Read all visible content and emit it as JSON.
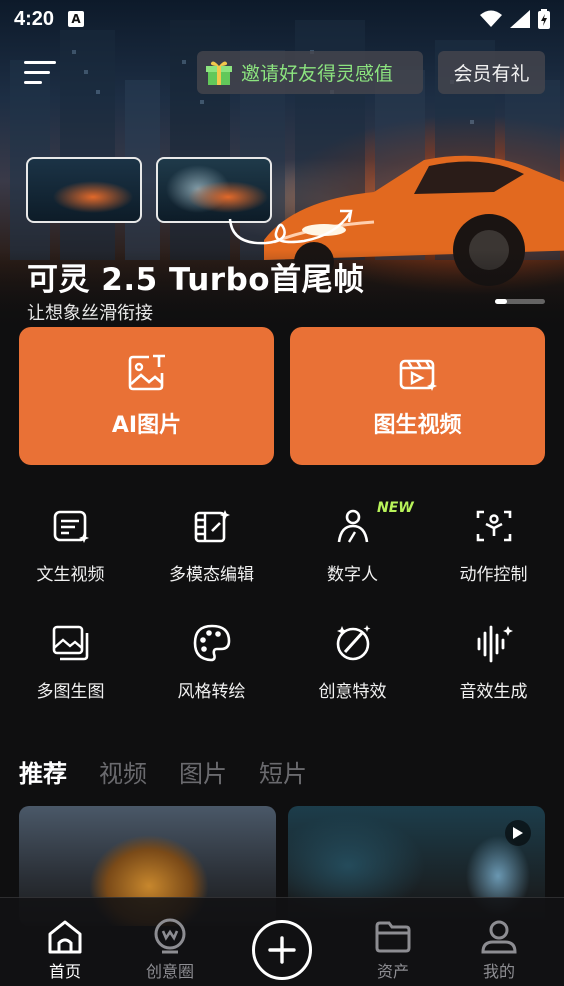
{
  "status": {
    "time": "4:20",
    "a_label": "A"
  },
  "header": {
    "invite_label": "邀请好友得灵感值",
    "vip_label": "会员有礼"
  },
  "hero": {
    "title": "可灵 2.5 Turbo首尾帧",
    "subtitle": "让想象丝滑衔接"
  },
  "cards": {
    "ai_image": "AI图片",
    "image_to_video": "图生视频"
  },
  "grid": {
    "items": [
      {
        "label": "文生视频",
        "icon": "text-video-icon"
      },
      {
        "label": "多模态编辑",
        "icon": "multimodal-edit-icon"
      },
      {
        "label": "数字人",
        "icon": "digital-human-icon"
      },
      {
        "label": "动作控制",
        "icon": "motion-control-icon"
      },
      {
        "label": "多图生图",
        "icon": "multi-image-icon"
      },
      {
        "label": "风格转绘",
        "icon": "palette-icon"
      },
      {
        "label": "创意特效",
        "icon": "creative-effect-icon"
      },
      {
        "label": "音效生成",
        "icon": "sound-wave-icon"
      }
    ],
    "new_badge": "NEW"
  },
  "tabs": [
    "推荐",
    "视频",
    "图片",
    "短片"
  ],
  "nav": {
    "home": "首页",
    "creative": "创意圈",
    "assets": "资产",
    "mine": "我的"
  },
  "colors": {
    "accent": "#e97136",
    "invite_text": "#8ce47f",
    "new_badge": "#b8f35a"
  }
}
